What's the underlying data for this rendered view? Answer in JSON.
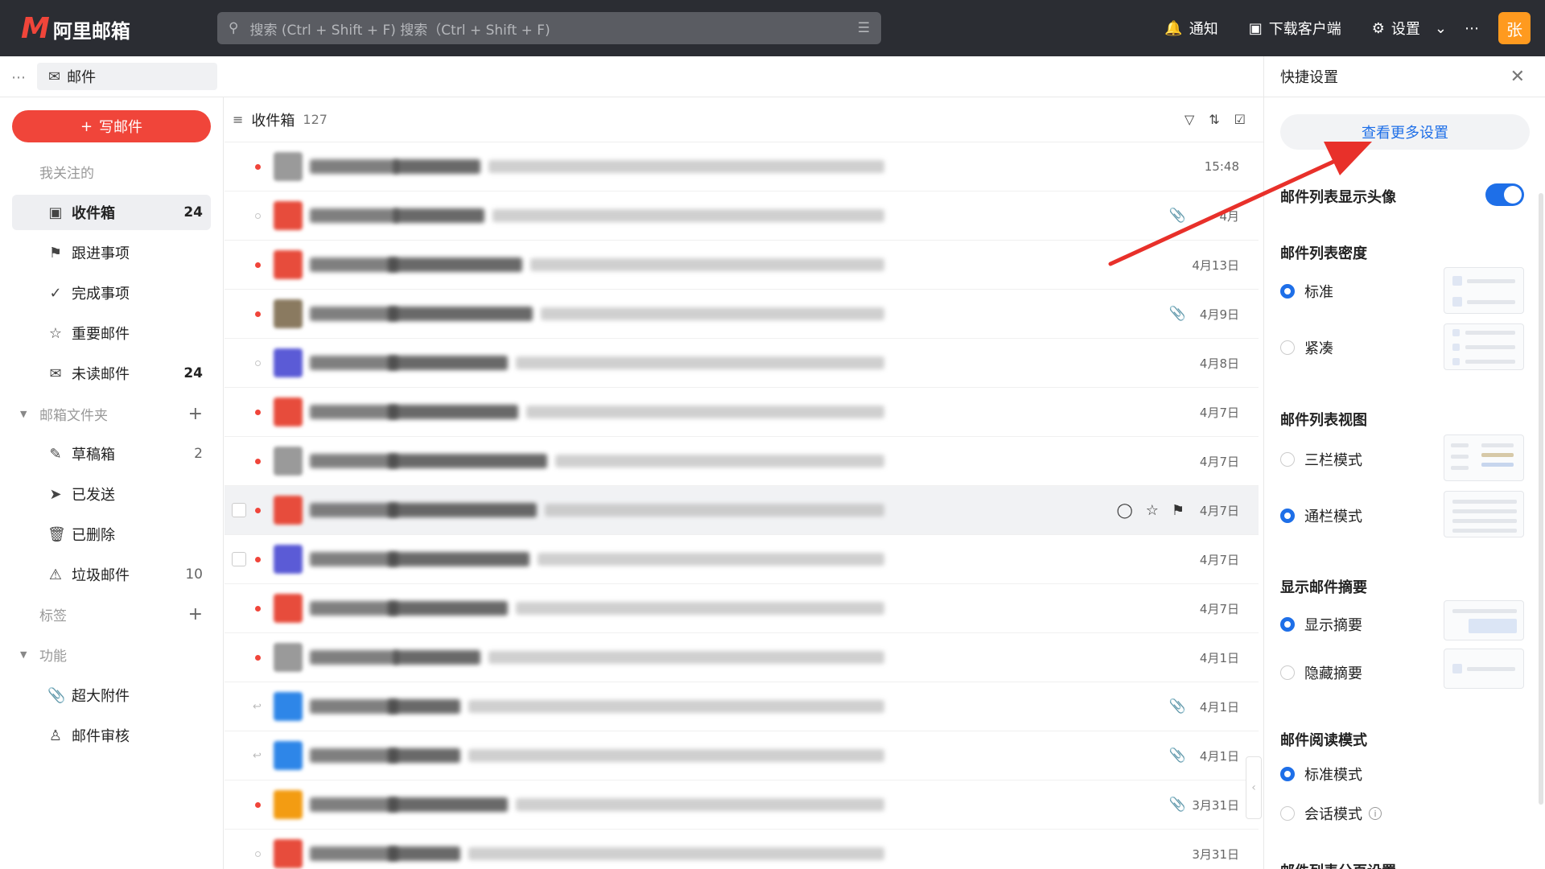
{
  "topbar": {
    "brand": "阿里邮箱",
    "search_placeholder": "搜索 (Ctrl + Shift + F)  搜索（Ctrl + Shift + F)",
    "notify": "通知",
    "download": "下载客户端",
    "settings": "设置",
    "avatar": "张"
  },
  "tab": {
    "mail": "邮件"
  },
  "sidebar": {
    "compose": "写邮件",
    "followed": "我关注的",
    "inbox": {
      "label": "收件箱",
      "count": "24"
    },
    "follow_up": "跟进事项",
    "done": "完成事项",
    "important": "重要邮件",
    "unread": {
      "label": "未读邮件",
      "count": "24"
    },
    "folders": "邮箱文件夹",
    "drafts": {
      "label": "草稿箱",
      "count": "2"
    },
    "sent": "已发送",
    "deleted": "已删除",
    "spam": {
      "label": "垃圾邮件",
      "count": "10"
    },
    "tags": "标签",
    "features": "功能",
    "large_attach": "超大附件",
    "review": "邮件审核"
  },
  "list": {
    "title": "收件箱",
    "count": "127",
    "rows": [
      {
        "date": "15:48",
        "read": false,
        "attach": false,
        "color": "#9a9a9a"
      },
      {
        "date": "4月",
        "read": true,
        "attach": true,
        "color": "#e74c3c"
      },
      {
        "date": "4月13日",
        "read": false,
        "attach": false,
        "color": "#e74c3c"
      },
      {
        "date": "4月9日",
        "read": false,
        "attach": true,
        "color": "#8a7a60"
      },
      {
        "date": "4月8日",
        "read": true,
        "attach": false,
        "color": "#5b5bd6"
      },
      {
        "date": "4月7日",
        "read": false,
        "attach": false,
        "color": "#e74c3c"
      },
      {
        "date": "4月7日",
        "read": false,
        "attach": false,
        "color": "#9a9a9a"
      },
      {
        "date": "4月7日",
        "read": false,
        "attach": false,
        "color": "#e74c3c"
      },
      {
        "date": "4月7日",
        "read": false,
        "attach": false,
        "color": "#5b5bd6"
      },
      {
        "date": "4月7日",
        "read": false,
        "attach": false,
        "color": "#e74c3c"
      },
      {
        "date": "4月1日",
        "read": false,
        "attach": false,
        "color": "#9a9a9a"
      },
      {
        "date": "4月1日",
        "read": true,
        "attach": true,
        "color": "#2e86e8"
      },
      {
        "date": "4月1日",
        "read": true,
        "attach": true,
        "color": "#2e86e8"
      },
      {
        "date": "3月31日",
        "read": false,
        "attach": true,
        "color": "#f39c12"
      },
      {
        "date": "3月31日",
        "read": true,
        "attach": false,
        "color": "#e74c3c"
      }
    ]
  },
  "panel": {
    "title": "快捷设置",
    "more": "查看更多设置",
    "avatar_toggle": "邮件列表显示头像",
    "density": "邮件列表密度",
    "standard": "标准",
    "compact": "紧凑",
    "view": "邮件列表视图",
    "three_col": "三栏模式",
    "full_col": "通栏模式",
    "summary": "显示邮件摘要",
    "show_summary": "显示摘要",
    "hide_summary": "隐藏摘要",
    "read_mode": "邮件阅读模式",
    "standard_mode": "标准模式",
    "conversation": "会话模式",
    "paging": "邮件列表分页设置"
  },
  "colors": {
    "accent": "#1e6fe8",
    "brand": "#f0453a"
  }
}
